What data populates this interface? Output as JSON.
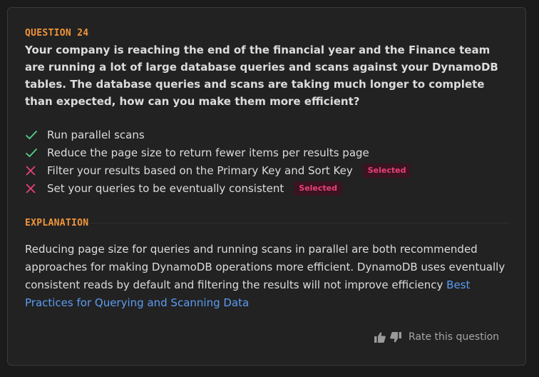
{
  "question": {
    "number_label": "QUESTION 24",
    "text": "Your company is reaching the end of the financial year and the Finance team are running a lot of large database queries and scans against your DynamoDB tables. The database queries and scans are taking much longer to complete than expected, how can you make them more efficient?"
  },
  "options": [
    {
      "label": "Run parallel scans",
      "status": "correct",
      "badge": ""
    },
    {
      "label": "Reduce the page size to return fewer items per results page",
      "status": "correct",
      "badge": ""
    },
    {
      "label": "Filter your results based on the Primary Key and Sort Key",
      "status": "incorrect",
      "badge": "Selected"
    },
    {
      "label": "Set your queries to be eventually consistent",
      "status": "incorrect",
      "badge": "Selected"
    }
  ],
  "explanation": {
    "title": "EXPLANATION",
    "text": "Reducing page size for queries and running scans in parallel are both recommended approaches for making DynamoDB operations more efficient. DynamoDB uses eventually consistent reads by default and filtering the results will not improve efficiency ",
    "link_text": "Best Practices for Querying and Scanning Data"
  },
  "rating": {
    "label": "Rate this question",
    "thumbs_up_icon": "thumbs-up-icon",
    "thumbs_down_icon": "thumbs-down-icon"
  },
  "colors": {
    "accent_orange": "#f0943a",
    "correct_green": "#55d18a",
    "incorrect_red": "#e8417a",
    "link_blue": "#5b9cf2"
  }
}
